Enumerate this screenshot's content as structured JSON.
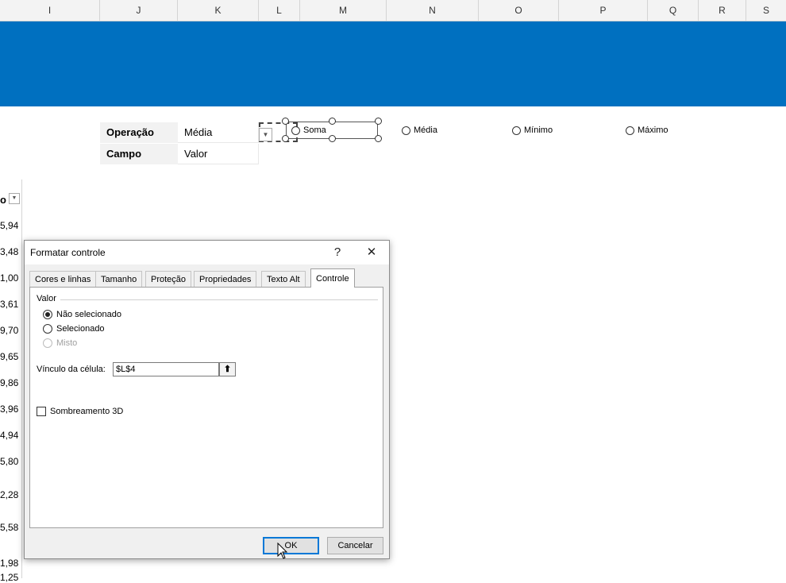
{
  "colors": {
    "banner": "#0070c0",
    "accent": "#0078d7"
  },
  "columns": [
    "I",
    "J",
    "K",
    "L",
    "M",
    "N",
    "O",
    "P",
    "Q",
    "R",
    "S"
  ],
  "table": {
    "rows": [
      {
        "label": "Operação",
        "value": "Média"
      },
      {
        "label": "Campo",
        "value": "Valor"
      }
    ]
  },
  "options": [
    "Soma",
    "Média",
    "Mínimo",
    "Máximo"
  ],
  "left_column": {
    "header_fragment": "o",
    "values": [
      "5,94",
      "3,48",
      "1,00",
      "3,61",
      "9,70",
      "9,65",
      "9,86",
      "3,96",
      "4,94",
      "5,80",
      "2,28",
      "5,58",
      "1,98",
      "1,25"
    ]
  },
  "dialog": {
    "title": "Formatar controle",
    "help": "?",
    "close": "✕",
    "tabs": [
      "Cores e linhas",
      "Tamanho",
      "Proteção",
      "Propriedades",
      "Texto Alt",
      "Controle"
    ],
    "active_tab": "Controle",
    "group_label": "Valor",
    "radios": [
      {
        "label": "Não selecionado",
        "checked": true,
        "disabled": false
      },
      {
        "label": "Selecionado",
        "checked": false,
        "disabled": false
      },
      {
        "label": "Misto",
        "checked": false,
        "disabled": true
      }
    ],
    "link_label": "Vínculo da célula:",
    "link_value": "$L$4",
    "shading_label": "Sombreamento 3D",
    "shading_checked": false,
    "ok": "OK",
    "cancel": "Cancelar"
  }
}
